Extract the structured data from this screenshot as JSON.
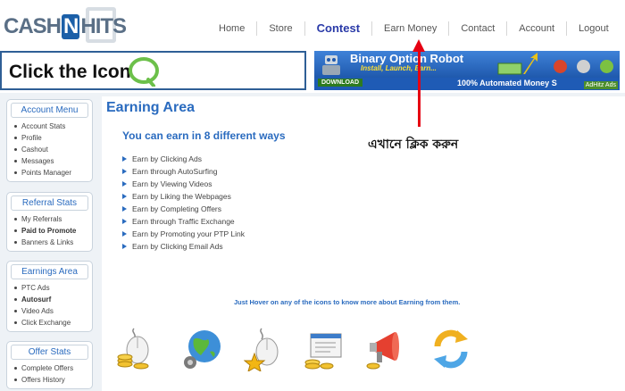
{
  "logo": {
    "part1": "CASH",
    "part2": "N",
    "part3": "HITS"
  },
  "nav": [
    {
      "label": "Home",
      "active": false
    },
    {
      "label": "Store",
      "active": false
    },
    {
      "label": "Contest",
      "active": true
    },
    {
      "label": "Earn Money",
      "active": false
    },
    {
      "label": "Contact",
      "active": false
    },
    {
      "label": "Account",
      "active": false
    },
    {
      "label": "Logout",
      "active": false
    }
  ],
  "banner_left": {
    "label": "Click the Icon"
  },
  "banner_right": {
    "title": "Binary Option Robot",
    "subtitle": "Install, Launch, Earn...",
    "download": "DOWNLOAD",
    "tagline": "100% Automated Money S",
    "badge": "AdHitz Ads"
  },
  "annotation": "এখানে ক্লিক করুন",
  "sidebar": [
    {
      "title": "Account Menu",
      "items": [
        {
          "label": "Account Stats",
          "bold": false
        },
        {
          "label": "Profile",
          "bold": false
        },
        {
          "label": "Cashout",
          "bold": false
        },
        {
          "label": "Messages",
          "bold": false
        },
        {
          "label": "Points Manager",
          "bold": false
        }
      ]
    },
    {
      "title": "Referral Stats",
      "items": [
        {
          "label": "My Referrals",
          "bold": false
        },
        {
          "label": "Paid to Promote",
          "bold": true
        },
        {
          "label": "Banners & Links",
          "bold": false
        }
      ]
    },
    {
      "title": "Earnings Area",
      "items": [
        {
          "label": "PTC Ads",
          "bold": false
        },
        {
          "label": "Autosurf",
          "bold": true
        },
        {
          "label": "Video Ads",
          "bold": false
        },
        {
          "label": "Click Exchange",
          "bold": false
        }
      ]
    },
    {
      "title": "Offer Stats",
      "items": [
        {
          "label": "Complete Offers",
          "bold": false
        },
        {
          "label": "Offers History",
          "bold": false
        }
      ]
    }
  ],
  "content": {
    "title": "Earning Area",
    "subtitle": "You can earn in 8 different ways",
    "ways": [
      "Earn by Clicking Ads",
      "Earn through AutoSurfing",
      "Earn by Viewing Videos",
      "Earn by Liking the Webpages",
      "Earn by Completing Offers",
      "Earn through Traffic Exchange",
      "Earn by Promoting your PTP Link",
      "Earn by Clicking Email Ads"
    ],
    "hover_note": "Just Hover on any of the icons to know more about Earning from them."
  },
  "icons": [
    "mouse-coins-icon",
    "globe-gear-icon",
    "mouse-star-icon",
    "form-coins-icon",
    "megaphone-icon",
    "refresh-icon"
  ],
  "colors": {
    "accent": "#2a6bbf",
    "annotation_arrow": "#e60012",
    "nav_active": "#2a3aa8"
  }
}
